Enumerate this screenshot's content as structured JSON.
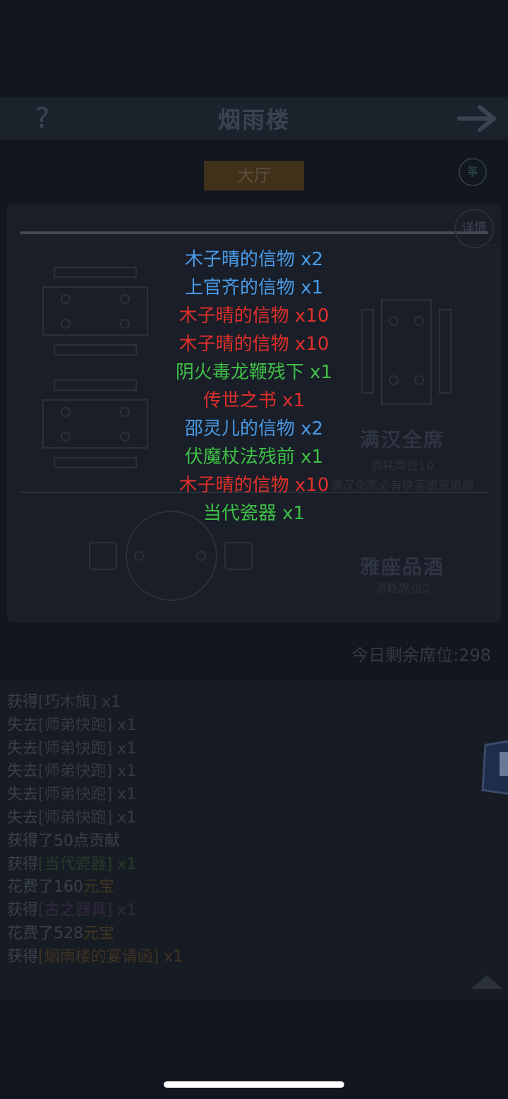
{
  "header": {
    "title": "烟雨楼",
    "help_icon": "question-mark-icon",
    "next_icon": "arrow-right-icon"
  },
  "hall_tab": "大厅",
  "top_right_icon_label": "筝",
  "details_label": "详情",
  "seating_options": [
    {
      "title": "满汉全席",
      "cost": "消耗席位10",
      "desc": "满汉全席必有侠客愿意追随"
    },
    {
      "title": "雅座品酒",
      "cost": "消耗席位2"
    }
  ],
  "remaining_seats": {
    "label": "今日剩余席位:",
    "value": "298"
  },
  "log": [
    {
      "prefix": "获得",
      "item": "[巧木旗]",
      "suffix": " x1",
      "style": "item-name"
    },
    {
      "prefix": "失去",
      "item": "[师弟快跑]",
      "suffix": " x1",
      "style": "item-name"
    },
    {
      "prefix": "失去",
      "item": "[师弟快跑]",
      "suffix": " x1",
      "style": "item-name"
    },
    {
      "prefix": "失去",
      "item": "[师弟快跑]",
      "suffix": " x1",
      "style": "item-name"
    },
    {
      "prefix": "失去",
      "item": "[师弟快跑]",
      "suffix": " x1",
      "style": "item-name"
    },
    {
      "prefix": "失去",
      "item": "[师弟快跑]",
      "suffix": " x1",
      "style": "item-name"
    },
    {
      "prefix": "获得了50点贡献",
      "item": "",
      "suffix": "",
      "style": "item-name"
    },
    {
      "prefix": "获得",
      "item": "[当代瓷器]",
      "suffix": " x1",
      "style": "item-green"
    },
    {
      "prefix": "花费了160",
      "item": "元宝",
      "suffix": "",
      "style": "gold"
    },
    {
      "prefix": "获得",
      "item": "[古之器具]",
      "suffix": " x1",
      "style": "item-purple"
    },
    {
      "prefix": "花费了528",
      "item": "元宝",
      "suffix": "",
      "style": "gold"
    },
    {
      "prefix": "获得",
      "item": "[烟雨楼的宴请函]",
      "suffix": " x1",
      "style": "item-orange"
    }
  ],
  "rewards": [
    {
      "text": "木子晴的信物 x2",
      "color": "blue"
    },
    {
      "text": "上官齐的信物 x1",
      "color": "blue"
    },
    {
      "text": "木子晴的信物 x10",
      "color": "red"
    },
    {
      "text": "木子晴的信物 x10",
      "color": "red"
    },
    {
      "text": "阴火毒龙鞭残下 x1",
      "color": "green"
    },
    {
      "text": "传世之书 x1",
      "color": "red"
    },
    {
      "text": "邵灵儿的信物 x2",
      "color": "blue"
    },
    {
      "text": "伏魔杖法残前 x1",
      "color": "green"
    },
    {
      "text": "木子晴的信物 x10",
      "color": "red"
    },
    {
      "text": "当代瓷器 x1",
      "color": "green"
    }
  ],
  "colors": {
    "blue": "#4a9be8",
    "red": "#e0302a",
    "green": "#3fc046",
    "background": "#121620"
  }
}
